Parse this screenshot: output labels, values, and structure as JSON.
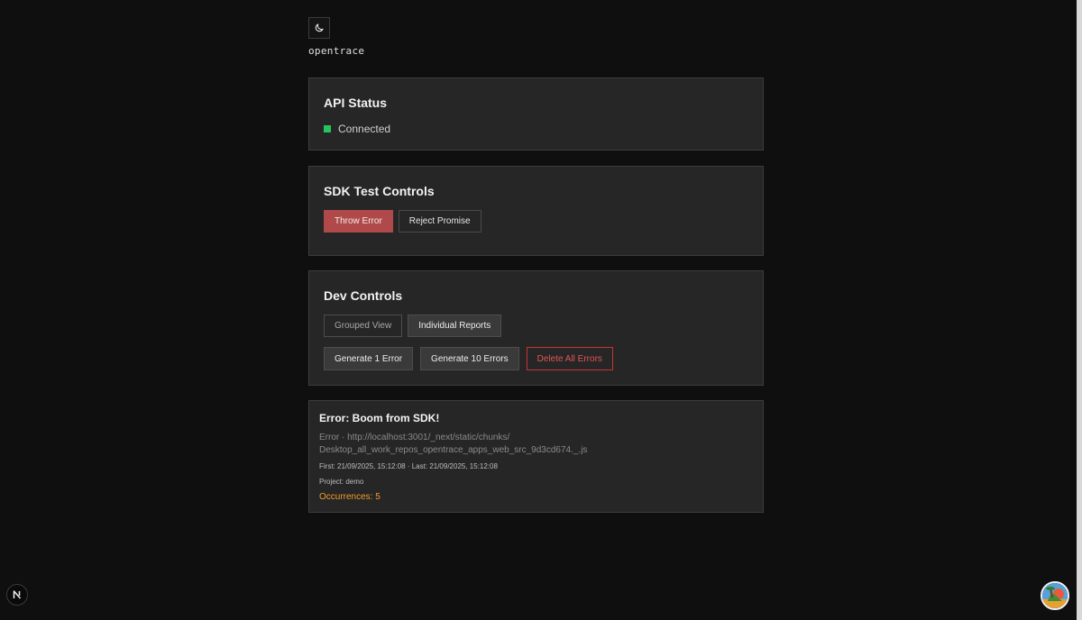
{
  "header": {
    "theme_toggle_icon": "moon-icon",
    "brand": "opentrace"
  },
  "api_status": {
    "title": "API Status",
    "status_text": "Connected",
    "status_color": "#22c55e"
  },
  "sdk_controls": {
    "title": "SDK Test Controls",
    "throw_error_label": "Throw Error",
    "reject_promise_label": "Reject Promise"
  },
  "dev_controls": {
    "title": "Dev Controls",
    "grouped_view_label": "Grouped View",
    "individual_reports_label": "Individual Reports",
    "generate_one_label": "Generate 1 Error",
    "generate_ten_label": "Generate 10 Errors",
    "delete_all_label": "Delete All Errors"
  },
  "error_item": {
    "title": "Error: Boom from SDK!",
    "source_line1": "Error · http://localhost:3001/_next/static/chunks/",
    "source_line2": "Desktop_all_work_repos_opentrace_apps_web_src_9d3cd674._.js",
    "times": "First: 21/09/2025, 15:12:08 · Last: 21/09/2025, 15:12:08",
    "project": "Project: demo",
    "occurrences": "Occurrences: 5",
    "occurrences_color": "#f39c2a"
  },
  "overlays": {
    "next_badge_letter": "N",
    "next_badge_icon": "nextjs-icon",
    "avatar_icon": "user-avatar-icon"
  },
  "colors": {
    "background": "#0f0f0f",
    "card": "#262626",
    "danger": "#b04a4a",
    "danger_outline": "#c43535"
  }
}
